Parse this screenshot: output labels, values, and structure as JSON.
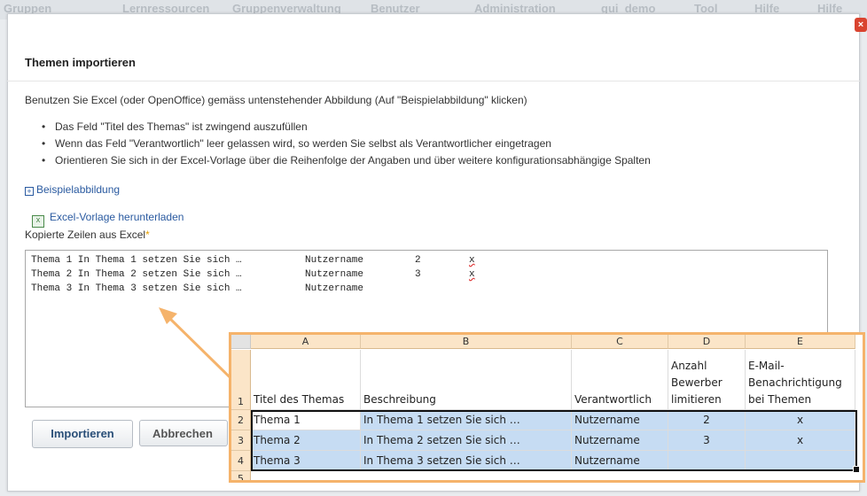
{
  "topnav": [
    "Gruppen",
    "Lernressourcen",
    "Gruppenverwaltung",
    "Benutzer",
    "Administration",
    "gui_demo",
    "Tool",
    "Hilfe",
    "Hilfe"
  ],
  "dialog": {
    "title": "Themen importieren",
    "intro": "Benutzen Sie Excel (oder OpenOffice) gemäss untenstehender Abbildung (Auf \"Beispielabbildung\" klicken)",
    "bullets": [
      "Das Feld \"Titel des Themas\" ist zwingend auszufüllen",
      "Wenn das Feld \"Verantwortlich\" leer gelassen wird, so werden Sie selbst als Verantwortlicher eingetragen",
      "Orientieren Sie sich in der Excel-Vorlage über die Reihenfolge der Angaben und über weitere konfigurationsabhängige Spalten"
    ],
    "example_link": "Beispielabbildung",
    "download_link": "Excel-Vorlage herunterladen",
    "field_label": "Kopierte Zeilen aus Excel",
    "required_mark": "*",
    "textarea_rows": [
      [
        "Thema 1 In Thema 1 setzen Sie sich …",
        "Nutzername",
        "2",
        "x"
      ],
      [
        "Thema 2 In Thema 2 setzen Sie sich …",
        "Nutzername",
        "3",
        "x"
      ],
      [
        "Thema 3 In Thema 3 setzen Sie sich …",
        "Nutzername",
        "",
        ""
      ]
    ],
    "import_button": "Importieren",
    "cancel_button": "Abbrechen"
  },
  "excel": {
    "col_letters": [
      "A",
      "B",
      "C",
      "D",
      "E"
    ],
    "row_numbers": [
      "1",
      "2",
      "3",
      "4",
      "5"
    ],
    "headers": [
      "Titel des Themas",
      "Beschreibung",
      "Verantwortlich",
      "Anzahl Bewerber limitieren",
      "E-Mail-Benachrichtigung bei Themen"
    ],
    "rows": [
      [
        "Thema 1",
        "In Thema 1 setzen Sie sich  …",
        "Nutzername",
        "2",
        "x"
      ],
      [
        "Thema 2",
        "In Thema 2 setzen Sie sich  …",
        "Nutzername",
        "3",
        "x"
      ],
      [
        "Thema 3",
        "In Thema 3 setzen Sie sich  …",
        "Nutzername",
        "",
        ""
      ]
    ]
  },
  "colors": {
    "accent_orange": "#f5b36b",
    "selection_blue": "#c6dcf3",
    "link_blue": "#2a5aa0"
  }
}
